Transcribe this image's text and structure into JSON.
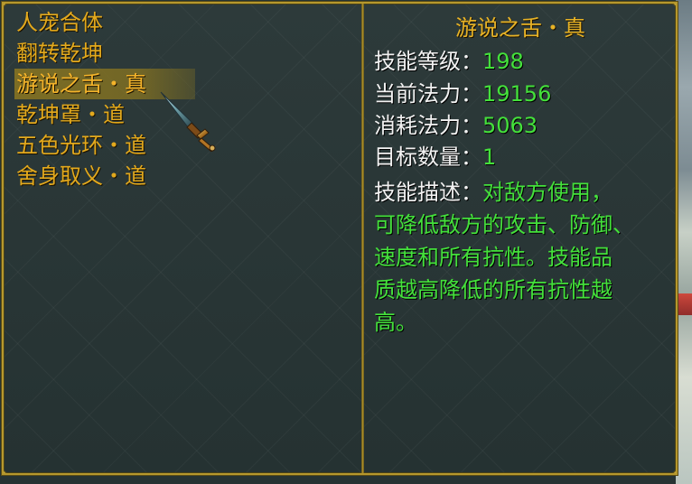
{
  "skill_list": {
    "items": [
      {
        "label": "人宠合体"
      },
      {
        "label": "翻转乾坤"
      },
      {
        "label": "游说之舌・真"
      },
      {
        "label": "乾坤罩・道"
      },
      {
        "label": "五色光环・道"
      },
      {
        "label": "舍身取义・道"
      }
    ],
    "selected_index": 2
  },
  "detail": {
    "title": "游说之舌・真",
    "level_label": "技能等级：",
    "level_value": "198",
    "mana_label": "当前法力：",
    "mana_value": "19156",
    "cost_label": "消耗法力：",
    "cost_value": "5063",
    "target_label": "目标数量：",
    "target_value": "1",
    "description_label": "技能描述：",
    "description_lines": [
      "对敌方使用，",
      "可降低敌方的攻击、防御、",
      "速度和所有抗性。技能品",
      "质越高降低的所有抗性越",
      "高。"
    ]
  },
  "colors": {
    "frame": "#b6982d",
    "skill_text": "#e3a91d",
    "selected_bg": "#847222",
    "label_text": "#f2f2f2",
    "value_text": "#44e13b"
  },
  "icons": {
    "cursor": "sword-cursor-icon"
  }
}
